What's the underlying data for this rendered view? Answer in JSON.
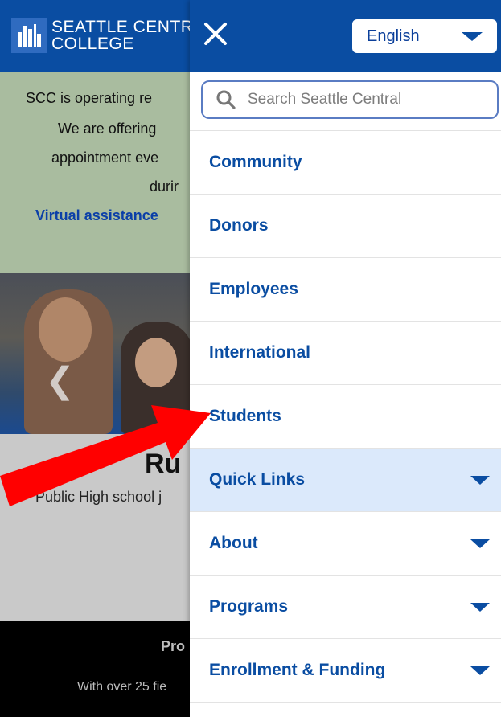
{
  "background": {
    "logo_text": "SEATTLE CENTRA\nCOLLEGE",
    "alert_lines": [
      "SCC is operating re",
      "We are offering",
      "appointment eve",
      "durir",
      "Virtual assistance"
    ],
    "hero_heading": "Ru",
    "hero_sub": "Public High school j",
    "footer_title": "Pro",
    "footer_text": "With over 25 fie"
  },
  "drawer": {
    "language": "English",
    "search_placeholder": "Search Seattle Central",
    "menu": [
      {
        "label": "Community",
        "expandable": false
      },
      {
        "label": "Donors",
        "expandable": false
      },
      {
        "label": "Employees",
        "expandable": false
      },
      {
        "label": "International",
        "expandable": false
      },
      {
        "label": "Students",
        "expandable": false
      },
      {
        "label": "Quick Links",
        "expandable": true,
        "active": true
      },
      {
        "label": "About",
        "expandable": true
      },
      {
        "label": "Programs",
        "expandable": true
      },
      {
        "label": "Enrollment & Funding",
        "expandable": true
      }
    ]
  },
  "colors": {
    "brand_blue": "#0a4da2",
    "active_row": "#dbe9fb",
    "alert_bg": "#a9bc9f",
    "annotation_red": "#ff0000"
  }
}
